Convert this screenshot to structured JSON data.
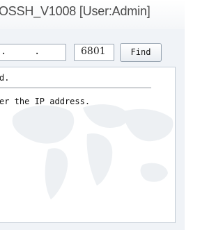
{
  "window": {
    "title": "OSSH_V1008 [User:Admin]"
  },
  "search": {
    "ip_separator": ".",
    "port_value": "6801",
    "find_label": "Find"
  },
  "output": {
    "lines": [
      "d.",
      "er the IP address."
    ]
  },
  "colors": {
    "panel_background": "#f0f3f7",
    "border": "#9aa6b3"
  }
}
